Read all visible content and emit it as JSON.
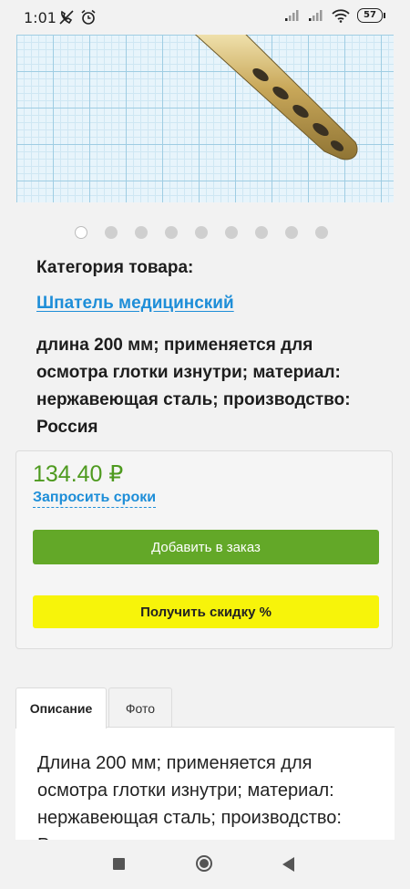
{
  "status_bar": {
    "time": "1:01",
    "battery": "57",
    "icons": [
      "no-call-icon",
      "alarm-icon",
      "signal-icon",
      "signal-icon",
      "wifi-icon",
      "battery-icon"
    ]
  },
  "product": {
    "carousel": {
      "total": 9,
      "active": 0
    },
    "category_heading": "Категория товара:",
    "category_link": "Шпатель медицинский",
    "short_description": "длина 200 мм; применяется для осмотра глотки изнутри; материал: нержавеющая сталь; производство: Россия"
  },
  "purchase": {
    "price": "134.40 ₽",
    "request_terms": "Запросить сроки",
    "add_to_order": "Добавить в заказ",
    "get_discount": "Получить скидку %"
  },
  "colors": {
    "price": "#4e9a1f",
    "link": "#1e8ed8",
    "primary_button": "#63a828",
    "discount_button": "#f7f40a"
  },
  "tabs": [
    {
      "label": "Описание",
      "active": true
    },
    {
      "label": "Фото",
      "active": false
    }
  ],
  "description": {
    "text": "Длина 200 мм; применяется для осмотра глотки изнутри; материал: нержавеющая сталь; производство: Россия"
  },
  "nav": {
    "icons": [
      "recent-apps-icon",
      "home-icon",
      "back-icon"
    ]
  }
}
